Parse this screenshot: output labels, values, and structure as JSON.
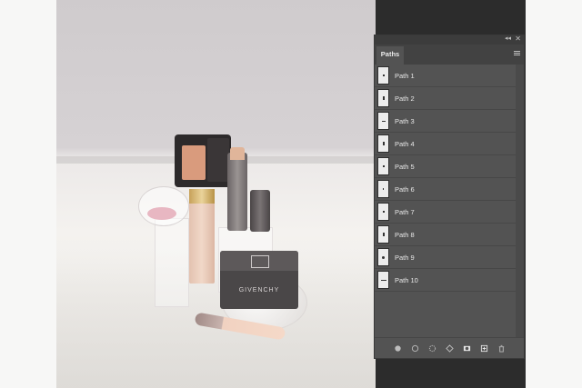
{
  "panel": {
    "tab_label": "Paths",
    "collapse_glyph": "◂◂",
    "close_glyph": "✕",
    "paths": [
      {
        "label": "Path 1"
      },
      {
        "label": "Path 2"
      },
      {
        "label": "Path 3"
      },
      {
        "label": "Path 4"
      },
      {
        "label": "Path 5"
      },
      {
        "label": "Path 6"
      },
      {
        "label": "Path 7"
      },
      {
        "label": "Path 8"
      },
      {
        "label": "Path 9"
      },
      {
        "label": "Path 10"
      }
    ],
    "footer_icons": [
      "fill-path-icon",
      "stroke-path-icon",
      "load-selection-icon",
      "make-work-path-icon",
      "add-mask-icon",
      "new-path-icon",
      "delete-path-icon"
    ]
  },
  "canvas": {
    "brand_text": "GIVENCHY"
  },
  "colors": {
    "panel_bg": "#535353",
    "panel_dark": "#3c3c3c",
    "canvas_gap": "#2c2c2c"
  }
}
